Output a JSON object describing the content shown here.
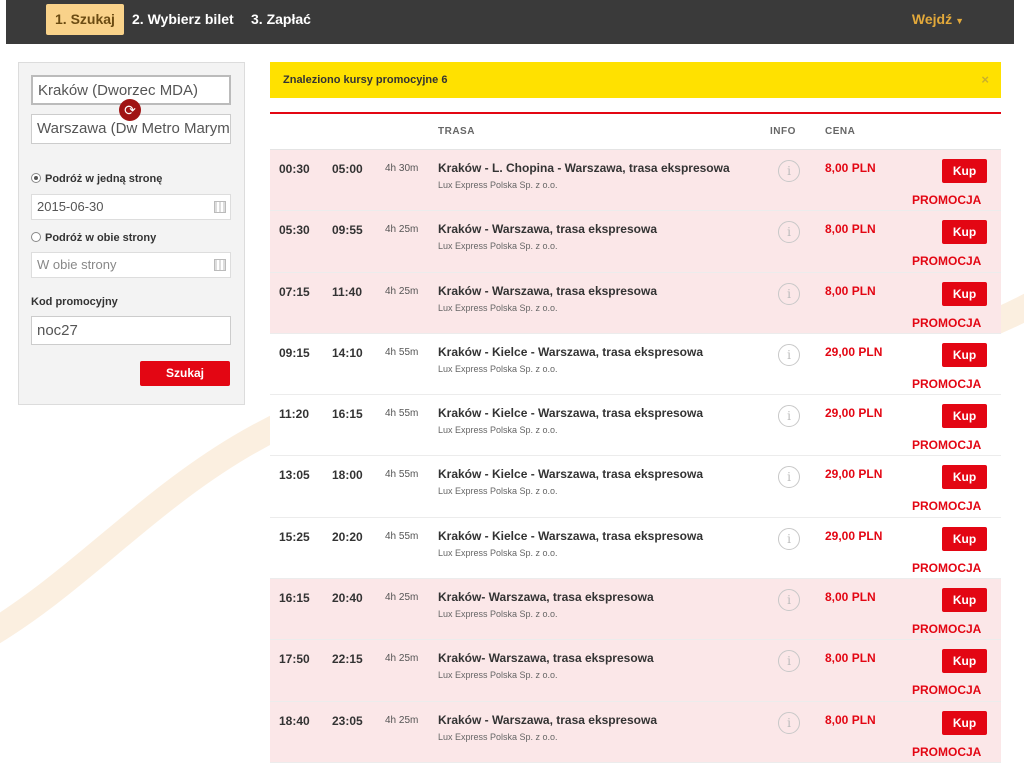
{
  "steps": [
    {
      "label": "1. Szukaj",
      "active": true
    },
    {
      "label": "2. Wybierz bilet",
      "active": false
    },
    {
      "label": "3. Zapłać",
      "active": false
    }
  ],
  "login": {
    "label": "Wejdź"
  },
  "search": {
    "from": "Kraków (Dworzec MDA)",
    "to": "Warszawa (Dw Metro Marymont)",
    "one_way_label": "Podróż w jedną stronę",
    "one_way_date": "2015-06-30",
    "round_trip_label": "Podróż w obie strony",
    "round_trip_placeholder": "W obie strony",
    "promo_code_label": "Kod promocyjny",
    "promo_code": "noc27",
    "submit_label": "Szukaj"
  },
  "banner": {
    "text": "Znaleziono kursy promocyjne 6",
    "close": "×"
  },
  "table": {
    "headers": {
      "route": "TRASA",
      "info": "INFO",
      "price": "CENA"
    },
    "buy_label": "Kup",
    "promo_label": "PROMOCJA",
    "rows": [
      {
        "dep": "00:30",
        "arr": "05:00",
        "dur": "4h 30m",
        "route": "Kraków - L. Chopina - Warszawa, trasa ekspresowa",
        "carrier": "Lux Express Polska Sp. z o.o.",
        "price": "8,00 PLN",
        "promo": true
      },
      {
        "dep": "05:30",
        "arr": "09:55",
        "dur": "4h 25m",
        "route": "Kraków - Warszawa, trasa ekspresowa",
        "carrier": "Lux Express Polska Sp. z o.o.",
        "price": "8,00 PLN",
        "promo": true
      },
      {
        "dep": "07:15",
        "arr": "11:40",
        "dur": "4h 25m",
        "route": "Kraków - Warszawa, trasa ekspresowa",
        "carrier": "Lux Express Polska Sp. z o.o.",
        "price": "8,00 PLN",
        "promo": true
      },
      {
        "dep": "09:15",
        "arr": "14:10",
        "dur": "4h 55m",
        "route": "Kraków - Kielce - Warszawa, trasa ekspresowa",
        "carrier": "Lux Express Polska Sp. z o.o.",
        "price": "29,00 PLN",
        "promo": false
      },
      {
        "dep": "11:20",
        "arr": "16:15",
        "dur": "4h 55m",
        "route": "Kraków - Kielce - Warszawa, trasa ekspresowa",
        "carrier": "Lux Express Polska Sp. z o.o.",
        "price": "29,00 PLN",
        "promo": false
      },
      {
        "dep": "13:05",
        "arr": "18:00",
        "dur": "4h 55m",
        "route": "Kraków - Kielce - Warszawa, trasa ekspresowa",
        "carrier": "Lux Express Polska Sp. z o.o.",
        "price": "29,00 PLN",
        "promo": false
      },
      {
        "dep": "15:25",
        "arr": "20:20",
        "dur": "4h 55m",
        "route": "Kraków - Kielce - Warszawa, trasa ekspresowa",
        "carrier": "Lux Express Polska Sp. z o.o.",
        "price": "29,00 PLN",
        "promo": false
      },
      {
        "dep": "16:15",
        "arr": "20:40",
        "dur": "4h 25m",
        "route": "Kraków- Warszawa, trasa ekspresowa",
        "carrier": "Lux Express Polska Sp. z o.o.",
        "price": "8,00 PLN",
        "promo": true
      },
      {
        "dep": "17:50",
        "arr": "22:15",
        "dur": "4h 25m",
        "route": "Kraków- Warszawa, trasa ekspresowa",
        "carrier": "Lux Express Polska Sp. z o.o.",
        "price": "8,00 PLN",
        "promo": true
      },
      {
        "dep": "18:40",
        "arr": "23:05",
        "dur": "4h 25m",
        "route": "Kraków - Warszawa, trasa ekspresowa",
        "carrier": "Lux Express Polska Sp. z o.o.",
        "price": "8,00 PLN",
        "promo": true
      }
    ]
  },
  "colors": {
    "brand_red": "#e30613",
    "banner_yellow": "#ffe100",
    "promo_row": "#fbe7e8",
    "topbar": "#3a3a3a"
  }
}
